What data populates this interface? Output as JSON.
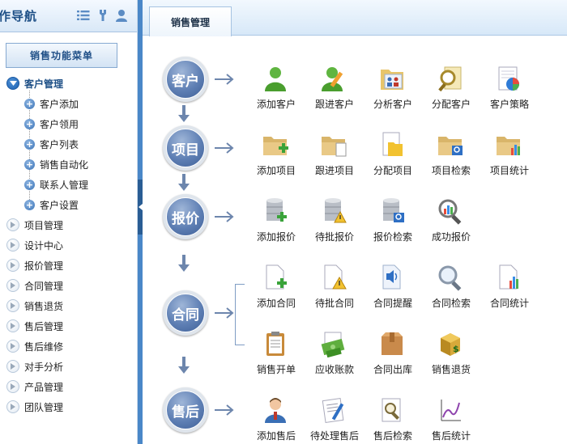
{
  "sidebar": {
    "title": "作导航",
    "header_icons": [
      "list-icon",
      "wrench-icon",
      "user-icon"
    ],
    "menu_button": "销售功能菜单",
    "open_group": {
      "label": "客户管理",
      "children": [
        "客户添加",
        "客户领用",
        "客户列表",
        "销售自动化",
        "联系人管理",
        "客户设置"
      ]
    },
    "groups": [
      "项目管理",
      "设计中心",
      "报价管理",
      "合同管理",
      "销售退货",
      "售后管理",
      "售后维修",
      "对手分析",
      "产品管理",
      "团队管理"
    ]
  },
  "main": {
    "tab": "销售管理",
    "stages": [
      "客户",
      "项目",
      "报价",
      "合同",
      "售后"
    ],
    "rows": [
      [
        {
          "label": "添加客户",
          "icon": "person-green-icon"
        },
        {
          "label": "跟进客户",
          "icon": "person-pencil-icon"
        },
        {
          "label": "分析客户",
          "icon": "folder-people-icon"
        },
        {
          "label": "分配客户",
          "icon": "magnifier-doc-icon"
        },
        {
          "label": "客户策略",
          "icon": "doc-piechart-icon"
        }
      ],
      [
        {
          "label": "添加项目",
          "icon": "folder-add-icon"
        },
        {
          "label": "跟进项目",
          "icon": "folder-doc-icon"
        },
        {
          "label": "分配项目",
          "icon": "doc-folder-icon"
        },
        {
          "label": "项目检索",
          "icon": "folder-search-icon"
        },
        {
          "label": "项目统计",
          "icon": "folder-chart-icon"
        }
      ],
      [
        {
          "label": "添加报价",
          "icon": "database-add-icon"
        },
        {
          "label": "待批报价",
          "icon": "database-warning-icon"
        },
        {
          "label": "报价检索",
          "icon": "database-search-icon"
        },
        {
          "label": "成功报价",
          "icon": "magnifier-chart-icon"
        }
      ],
      [
        {
          "label": "添加合同",
          "icon": "doc-add-icon"
        },
        {
          "label": "待批合同",
          "icon": "doc-warning-icon"
        },
        {
          "label": "合同提醒",
          "icon": "doc-sound-icon"
        },
        {
          "label": "合同检索",
          "icon": "magnifier-icon"
        },
        {
          "label": "合同统计",
          "icon": "doc-chart-icon"
        }
      ],
      [
        {
          "label": "销售开单",
          "icon": "clipboard-icon"
        },
        {
          "label": "应收账款",
          "icon": "money-icon"
        },
        {
          "label": "合同出库",
          "icon": "box-icon"
        },
        {
          "label": "销售退货",
          "icon": "dollar-box-icon"
        }
      ],
      [
        {
          "label": "添加售后",
          "icon": "service-person-icon"
        },
        {
          "label": "待处理售后",
          "icon": "doc-pen-icon"
        },
        {
          "label": "售后检索",
          "icon": "doc-magnifier-icon"
        },
        {
          "label": "售后统计",
          "icon": "line-chart-icon"
        }
      ]
    ]
  }
}
